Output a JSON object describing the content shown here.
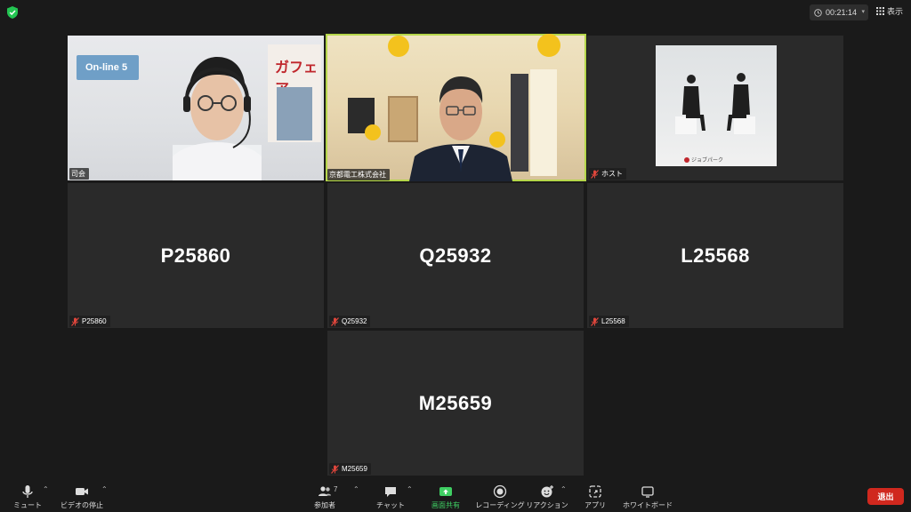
{
  "top": {
    "timer": "00:21:14",
    "view_label": "表示"
  },
  "tiles": [
    {
      "name": "司会",
      "kind": "video"
    },
    {
      "name": "京都電工株式会社",
      "kind": "video",
      "active": true
    },
    {
      "name": "ホスト",
      "kind": "video",
      "muted": true
    },
    {
      "display": "P25860",
      "name": "P25860",
      "muted": true
    },
    {
      "display": "Q25932",
      "name": "Q25932",
      "muted": true
    },
    {
      "display": "L25568",
      "name": "L25568",
      "muted": true
    },
    {
      "display": "M25659",
      "name": "M25659",
      "muted": true
    }
  ],
  "scene": {
    "banner_text": "On-line 5",
    "poster_text": "ガフェア",
    "brand_text": "ジョブパーク"
  },
  "toolbar": {
    "mute": "ミュート",
    "stop_video": "ビデオの停止",
    "participants": "参加者",
    "participants_count": "7",
    "chat": "チャット",
    "share_screen": "画面共有",
    "recording": "レコーディング",
    "reactions": "リアクション",
    "apps": "アプリ",
    "whiteboard": "ホワイトボード",
    "leave": "退出"
  },
  "colors": {
    "background": "#1a1a1a",
    "tile": "#2a2a2a",
    "active_speaker": "#b5d64a",
    "share_green": "#3fcf63",
    "leave_red": "#d0281e",
    "muted_icon": "#e0463c"
  }
}
